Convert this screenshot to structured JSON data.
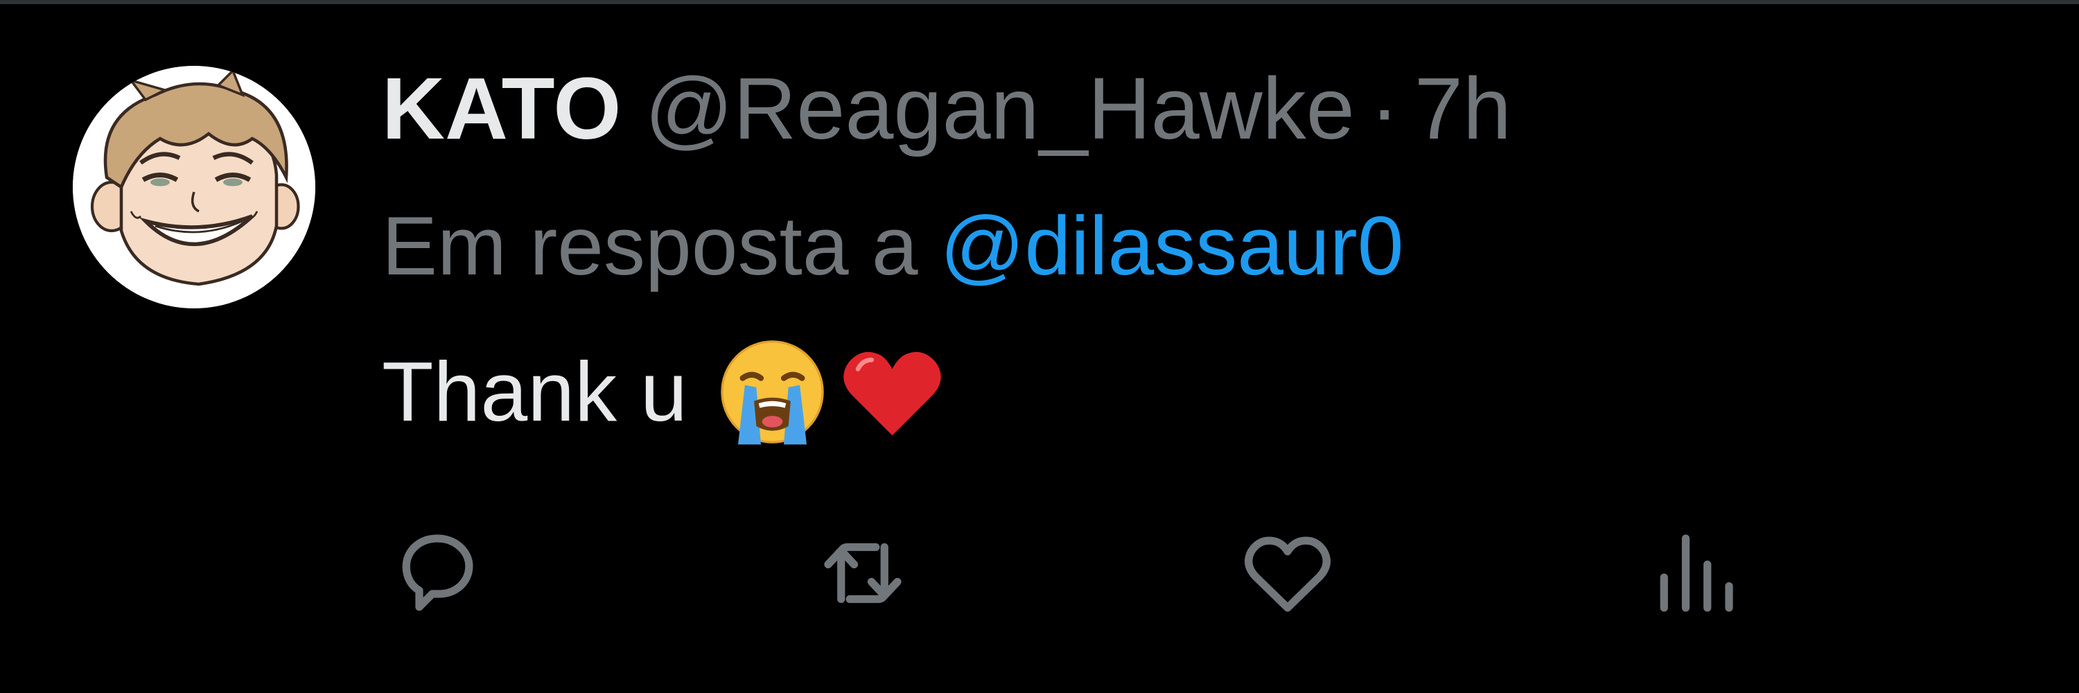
{
  "tweet": {
    "author": {
      "display_name": "KATO",
      "handle": "@Reagan_Hawke",
      "avatar_icon": "cartoon-avatar"
    },
    "separator": "·",
    "timestamp": "7h",
    "reply_context": {
      "prefix": "Em resposta a",
      "mention": "@dilassaur0"
    },
    "text": "Thank u",
    "emojis": [
      "loudly-crying-face-emoji",
      "red-heart-emoji"
    ],
    "actions": [
      {
        "name": "reply",
        "icon": "reply-icon"
      },
      {
        "name": "retweet",
        "icon": "retweet-icon"
      },
      {
        "name": "like",
        "icon": "heart-icon"
      },
      {
        "name": "views",
        "icon": "analytics-icon"
      }
    ]
  },
  "colors": {
    "background": "#000000",
    "primary_text": "#e7e9ea",
    "secondary_text": "#71767b",
    "link": "#1d9bf0"
  }
}
